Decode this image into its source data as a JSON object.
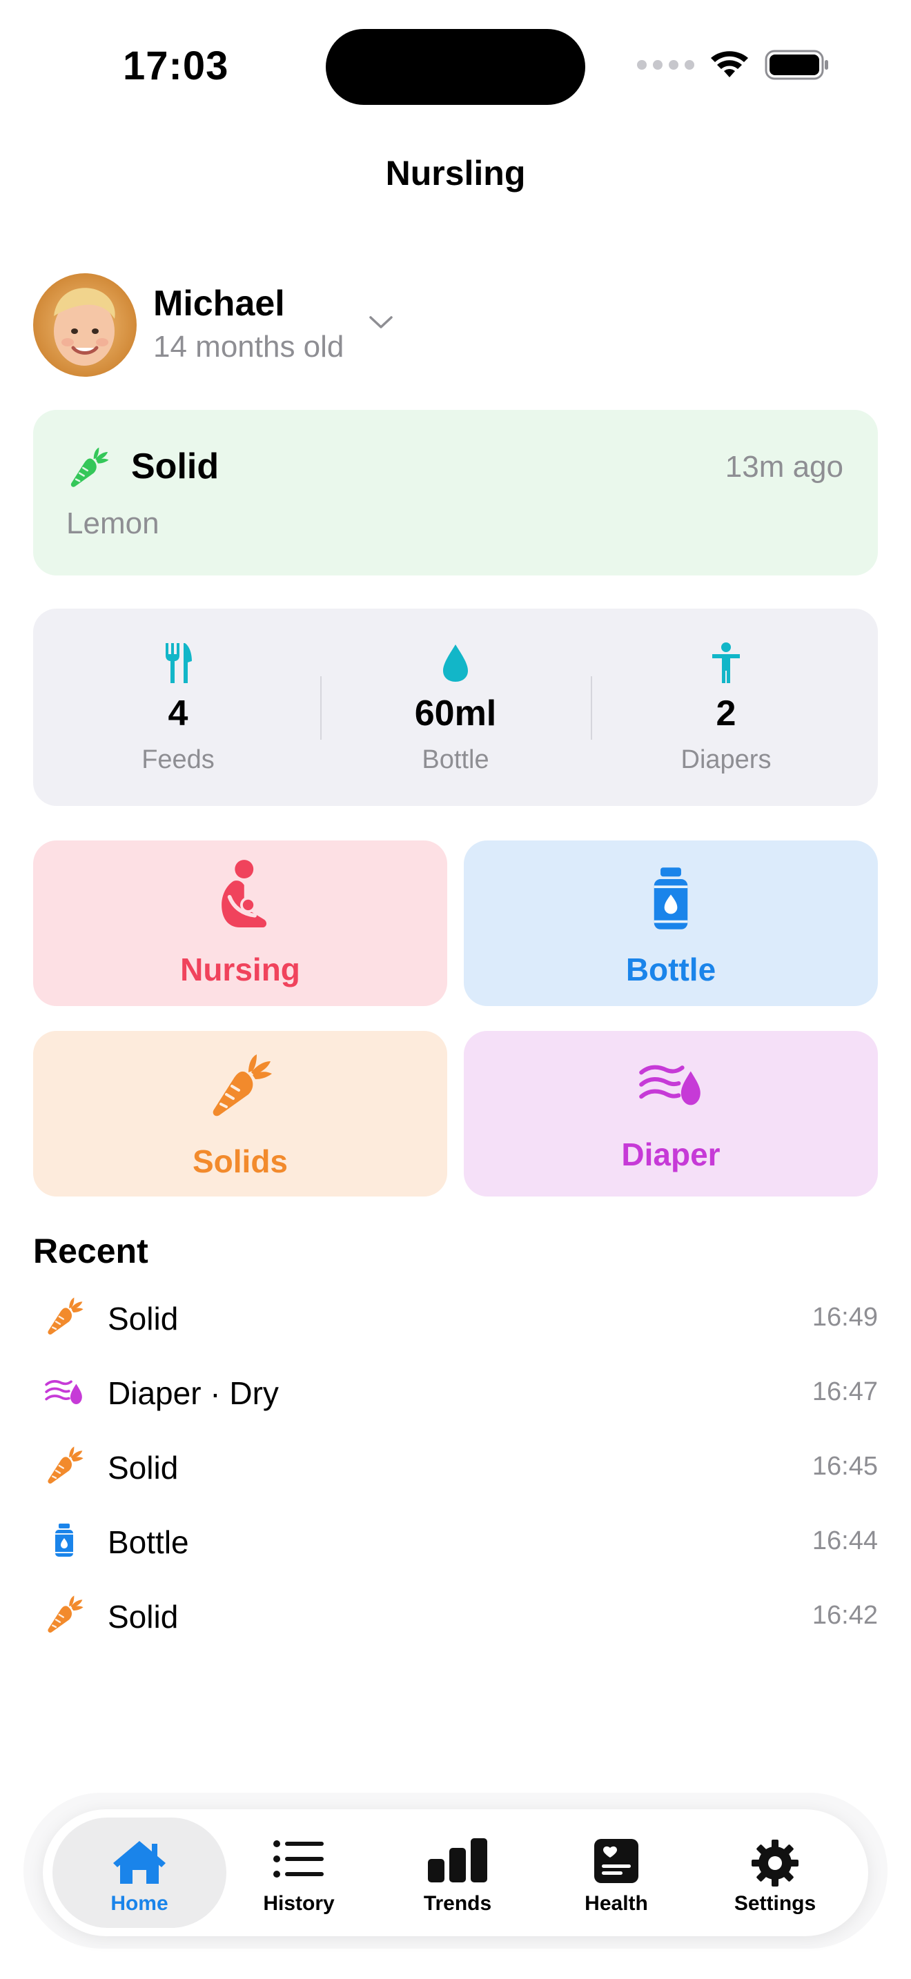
{
  "status_bar": {
    "time": "17:03"
  },
  "app": {
    "title": "Nursling"
  },
  "profile": {
    "name": "Michael",
    "age": "14 months old"
  },
  "last_activity": {
    "title": "Solid",
    "ago": "13m ago",
    "detail": "Lemon",
    "icon": "carrot-icon"
  },
  "stats": [
    {
      "value": "4",
      "label": "Feeds",
      "icon": "fork-knife-icon"
    },
    {
      "value": "60ml",
      "label": "Bottle",
      "icon": "drop-icon"
    },
    {
      "value": "2",
      "label": "Diapers",
      "icon": "figure-icon"
    }
  ],
  "actions": [
    {
      "label": "Nursing",
      "icon": "nursing-icon",
      "color": "#f0435c",
      "bg": "#fde0e4"
    },
    {
      "label": "Bottle",
      "icon": "bottle-icon",
      "color": "#1a84ea",
      "bg": "#dcebfb"
    },
    {
      "label": "Solids",
      "icon": "carrot-icon",
      "color": "#f28a2c",
      "bg": "#fdebdc"
    },
    {
      "label": "Diaper",
      "icon": "diaper-icon",
      "color": "#c63ad7",
      "bg": "#f5e0f8"
    }
  ],
  "recent": {
    "heading": "Recent",
    "items": [
      {
        "label": "Solid",
        "time": "16:49",
        "icon": "carrot-icon"
      },
      {
        "label": "Diaper · Dry",
        "time": "16:47",
        "icon": "diaper-icon"
      },
      {
        "label": "Solid",
        "time": "16:45",
        "icon": "carrot-icon"
      },
      {
        "label": "Bottle",
        "time": "16:44",
        "icon": "bottle-icon"
      },
      {
        "label": "Solid",
        "time": "16:42",
        "icon": "carrot-icon"
      }
    ]
  },
  "tabs": [
    {
      "label": "Home",
      "icon": "house-icon",
      "active": true
    },
    {
      "label": "History",
      "icon": "list-icon",
      "active": false
    },
    {
      "label": "Trends",
      "icon": "chart-bars-icon",
      "active": false
    },
    {
      "label": "Health",
      "icon": "health-record-icon",
      "active": false
    },
    {
      "label": "Settings",
      "icon": "gear-icon",
      "active": false
    }
  ],
  "colors": {
    "accent": "#1a84ea",
    "teal": "#12b6c8",
    "green": "#34c759",
    "secondary_text": "#8e8e93"
  }
}
